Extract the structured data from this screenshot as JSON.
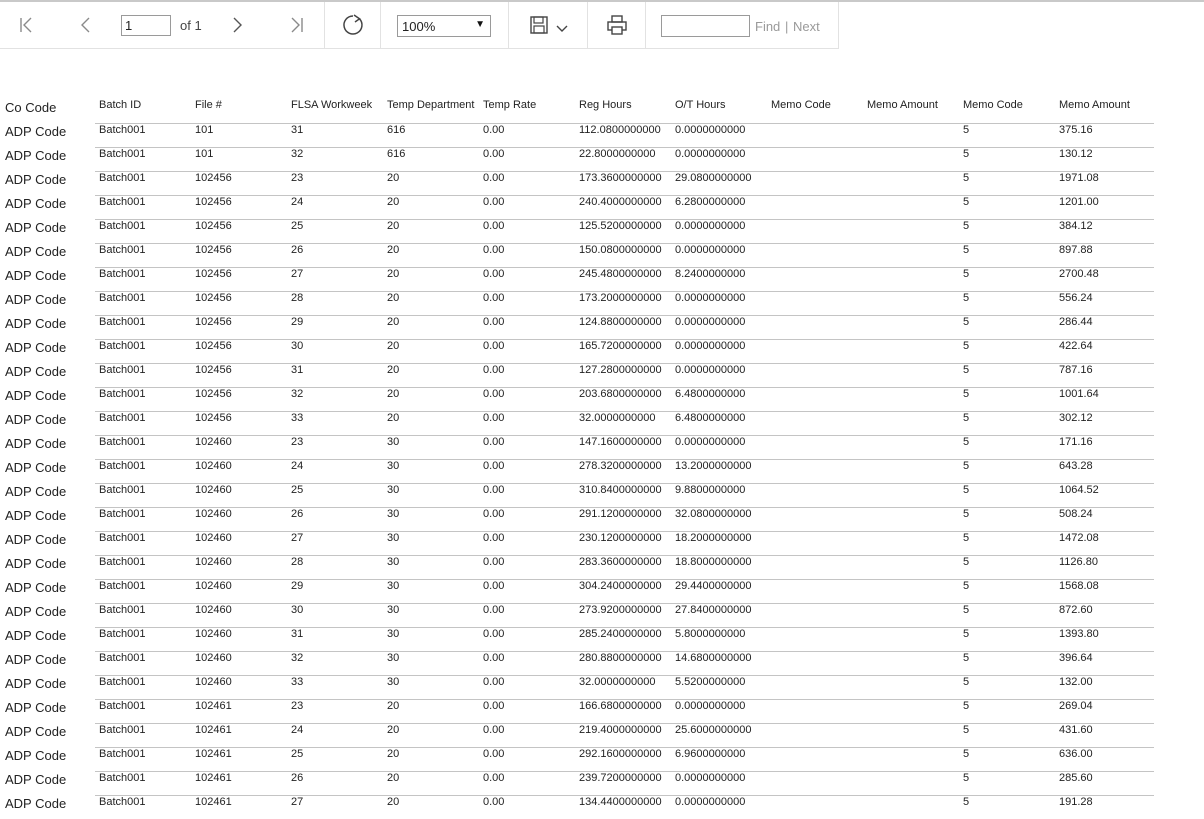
{
  "toolbar": {
    "page_current": "1",
    "page_of": "of 1",
    "zoom": "100%",
    "find_placeholder": "",
    "find_label": "Find",
    "next_label": "Next",
    "separator": "|"
  },
  "table": {
    "headers": [
      "Co Code",
      "Batch ID",
      "File #",
      "FLSA Workweek",
      "Temp Department",
      "Temp Rate",
      "Reg Hours",
      "O/T Hours",
      "Memo Code",
      "Memo Amount",
      "Memo Code",
      "Memo Amount"
    ],
    "rows": [
      [
        "ADP Code",
        "Batch001",
        "101",
        "31",
        "616",
        "0.00",
        "112.0800000000",
        "0.0000000000",
        "",
        "",
        "5",
        "375.16"
      ],
      [
        "ADP Code",
        "Batch001",
        "101",
        "32",
        "616",
        "0.00",
        "22.8000000000",
        "0.0000000000",
        "",
        "",
        "5",
        "130.12"
      ],
      [
        "ADP Code",
        "Batch001",
        "102456",
        "23",
        "20",
        "0.00",
        "173.3600000000",
        "29.0800000000",
        "",
        "",
        "5",
        "1971.08"
      ],
      [
        "ADP Code",
        "Batch001",
        "102456",
        "24",
        "20",
        "0.00",
        "240.4000000000",
        "6.2800000000",
        "",
        "",
        "5",
        "1201.00"
      ],
      [
        "ADP Code",
        "Batch001",
        "102456",
        "25",
        "20",
        "0.00",
        "125.5200000000",
        "0.0000000000",
        "",
        "",
        "5",
        "384.12"
      ],
      [
        "ADP Code",
        "Batch001",
        "102456",
        "26",
        "20",
        "0.00",
        "150.0800000000",
        "0.0000000000",
        "",
        "",
        "5",
        "897.88"
      ],
      [
        "ADP Code",
        "Batch001",
        "102456",
        "27",
        "20",
        "0.00",
        "245.4800000000",
        "8.2400000000",
        "",
        "",
        "5",
        "2700.48"
      ],
      [
        "ADP Code",
        "Batch001",
        "102456",
        "28",
        "20",
        "0.00",
        "173.2000000000",
        "0.0000000000",
        "",
        "",
        "5",
        "556.24"
      ],
      [
        "ADP Code",
        "Batch001",
        "102456",
        "29",
        "20",
        "0.00",
        "124.8800000000",
        "0.0000000000",
        "",
        "",
        "5",
        "286.44"
      ],
      [
        "ADP Code",
        "Batch001",
        "102456",
        "30",
        "20",
        "0.00",
        "165.7200000000",
        "0.0000000000",
        "",
        "",
        "5",
        "422.64"
      ],
      [
        "ADP Code",
        "Batch001",
        "102456",
        "31",
        "20",
        "0.00",
        "127.2800000000",
        "0.0000000000",
        "",
        "",
        "5",
        "787.16"
      ],
      [
        "ADP Code",
        "Batch001",
        "102456",
        "32",
        "20",
        "0.00",
        "203.6800000000",
        "6.4800000000",
        "",
        "",
        "5",
        "1001.64"
      ],
      [
        "ADP Code",
        "Batch001",
        "102456",
        "33",
        "20",
        "0.00",
        "32.0000000000",
        "6.4800000000",
        "",
        "",
        "5",
        "302.12"
      ],
      [
        "ADP Code",
        "Batch001",
        "102460",
        "23",
        "30",
        "0.00",
        "147.1600000000",
        "0.0000000000",
        "",
        "",
        "5",
        "171.16"
      ],
      [
        "ADP Code",
        "Batch001",
        "102460",
        "24",
        "30",
        "0.00",
        "278.3200000000",
        "13.2000000000",
        "",
        "",
        "5",
        "643.28"
      ],
      [
        "ADP Code",
        "Batch001",
        "102460",
        "25",
        "30",
        "0.00",
        "310.8400000000",
        "9.8800000000",
        "",
        "",
        "5",
        "1064.52"
      ],
      [
        "ADP Code",
        "Batch001",
        "102460",
        "26",
        "30",
        "0.00",
        "291.1200000000",
        "32.0800000000",
        "",
        "",
        "5",
        "508.24"
      ],
      [
        "ADP Code",
        "Batch001",
        "102460",
        "27",
        "30",
        "0.00",
        "230.1200000000",
        "18.2000000000",
        "",
        "",
        "5",
        "1472.08"
      ],
      [
        "ADP Code",
        "Batch001",
        "102460",
        "28",
        "30",
        "0.00",
        "283.3600000000",
        "18.8000000000",
        "",
        "",
        "5",
        "1126.80"
      ],
      [
        "ADP Code",
        "Batch001",
        "102460",
        "29",
        "30",
        "0.00",
        "304.2400000000",
        "29.4400000000",
        "",
        "",
        "5",
        "1568.08"
      ],
      [
        "ADP Code",
        "Batch001",
        "102460",
        "30",
        "30",
        "0.00",
        "273.9200000000",
        "27.8400000000",
        "",
        "",
        "5",
        "872.60"
      ],
      [
        "ADP Code",
        "Batch001",
        "102460",
        "31",
        "30",
        "0.00",
        "285.2400000000",
        "5.8000000000",
        "",
        "",
        "5",
        "1393.80"
      ],
      [
        "ADP Code",
        "Batch001",
        "102460",
        "32",
        "30",
        "0.00",
        "280.8800000000",
        "14.6800000000",
        "",
        "",
        "5",
        "396.64"
      ],
      [
        "ADP Code",
        "Batch001",
        "102460",
        "33",
        "30",
        "0.00",
        "32.0000000000",
        "5.5200000000",
        "",
        "",
        "5",
        "132.00"
      ],
      [
        "ADP Code",
        "Batch001",
        "102461",
        "23",
        "20",
        "0.00",
        "166.6800000000",
        "0.0000000000",
        "",
        "",
        "5",
        "269.04"
      ],
      [
        "ADP Code",
        "Batch001",
        "102461",
        "24",
        "20",
        "0.00",
        "219.4000000000",
        "25.6000000000",
        "",
        "",
        "5",
        "431.60"
      ],
      [
        "ADP Code",
        "Batch001",
        "102461",
        "25",
        "20",
        "0.00",
        "292.1600000000",
        "6.9600000000",
        "",
        "",
        "5",
        "636.00"
      ],
      [
        "ADP Code",
        "Batch001",
        "102461",
        "26",
        "20",
        "0.00",
        "239.7200000000",
        "0.0000000000",
        "",
        "",
        "5",
        "285.60"
      ],
      [
        "ADP Code",
        "Batch001",
        "102461",
        "27",
        "20",
        "0.00",
        "134.4400000000",
        "0.0000000000",
        "",
        "",
        "5",
        "191.28"
      ]
    ]
  }
}
